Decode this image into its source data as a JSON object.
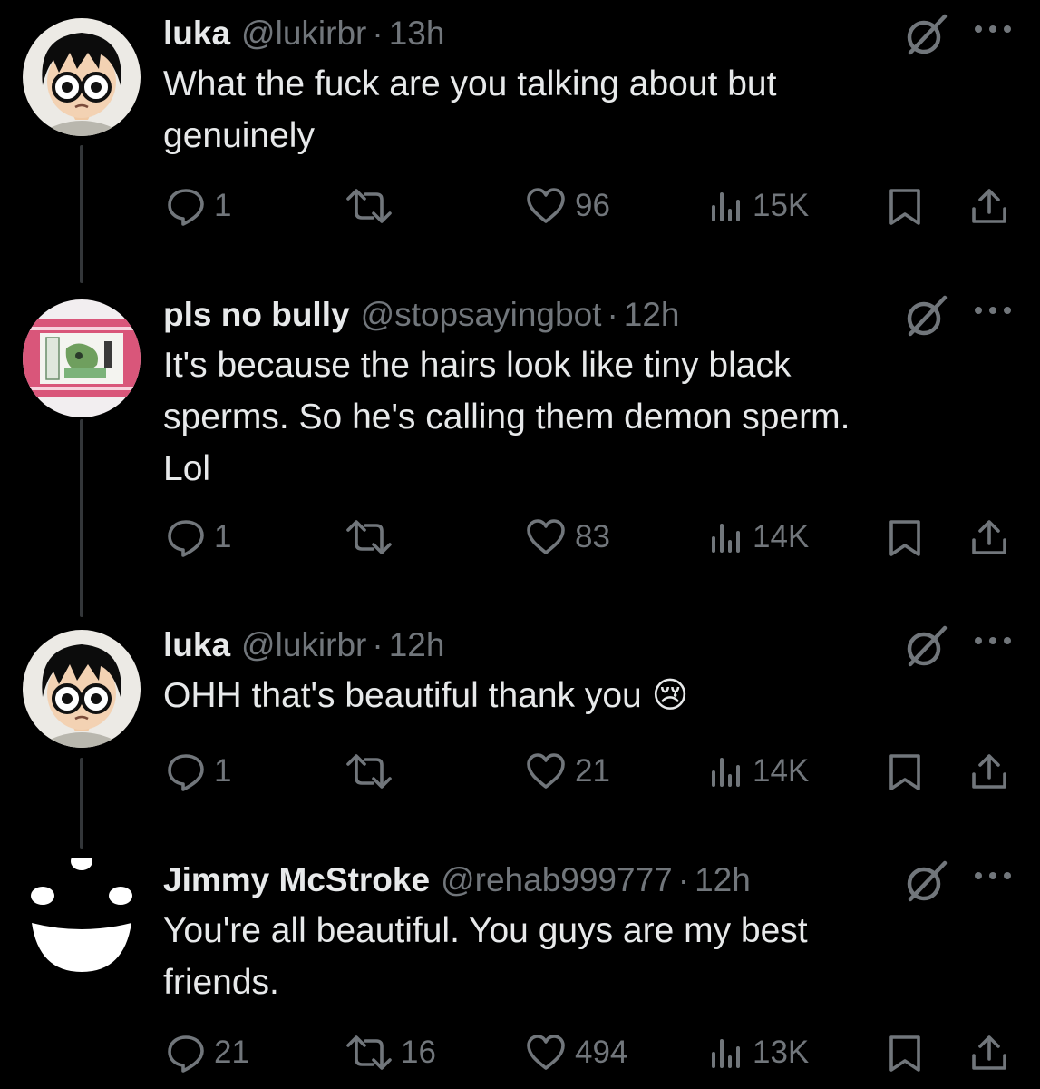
{
  "colors": {
    "background": "#000000",
    "text": "#e7e9ea",
    "muted": "#71767b",
    "thread_line": "#333639"
  },
  "tweets": [
    {
      "name": "luka",
      "handle": "@lukirbr",
      "separator": "·",
      "time": "13h",
      "text": "What the fuck are you talking about but\ngenuinely",
      "reply_count": "1",
      "retweet_count": "",
      "like_count": "96",
      "view_count": "15K",
      "avatar": "luka-avatar"
    },
    {
      "name": "pls no bully",
      "handle": "@stopsayingbot",
      "separator": "·",
      "time": "12h",
      "text": "It's because the hairs look like tiny black\nsperms. So he's calling them demon sperm.\nLol",
      "reply_count": "1",
      "retweet_count": "",
      "like_count": "83",
      "view_count": "14K",
      "avatar": "pink-frame-avatar"
    },
    {
      "name": "luka",
      "handle": "@lukirbr",
      "separator": "·",
      "time": "12h",
      "text": "OHH that's beautiful thank you 😢",
      "reply_count": "1",
      "retweet_count": "",
      "like_count": "21",
      "view_count": "14K",
      "avatar": "luka-avatar"
    },
    {
      "name": "Jimmy McStroke",
      "handle": "@rehab999777",
      "separator": "·",
      "time": "12h",
      "text": "You're all beautiful. You guys are my best\nfriends.",
      "reply_count": "21",
      "retweet_count": "16",
      "like_count": "494",
      "view_count": "13K",
      "avatar": "smiley-face-avatar"
    }
  ],
  "icons": {
    "grok": "grok-icon",
    "more": "more-icon",
    "reply": "reply-icon",
    "retweet": "retweet-icon",
    "like": "like-icon",
    "views": "views-icon",
    "bookmark": "bookmark-icon",
    "share": "share-icon"
  }
}
